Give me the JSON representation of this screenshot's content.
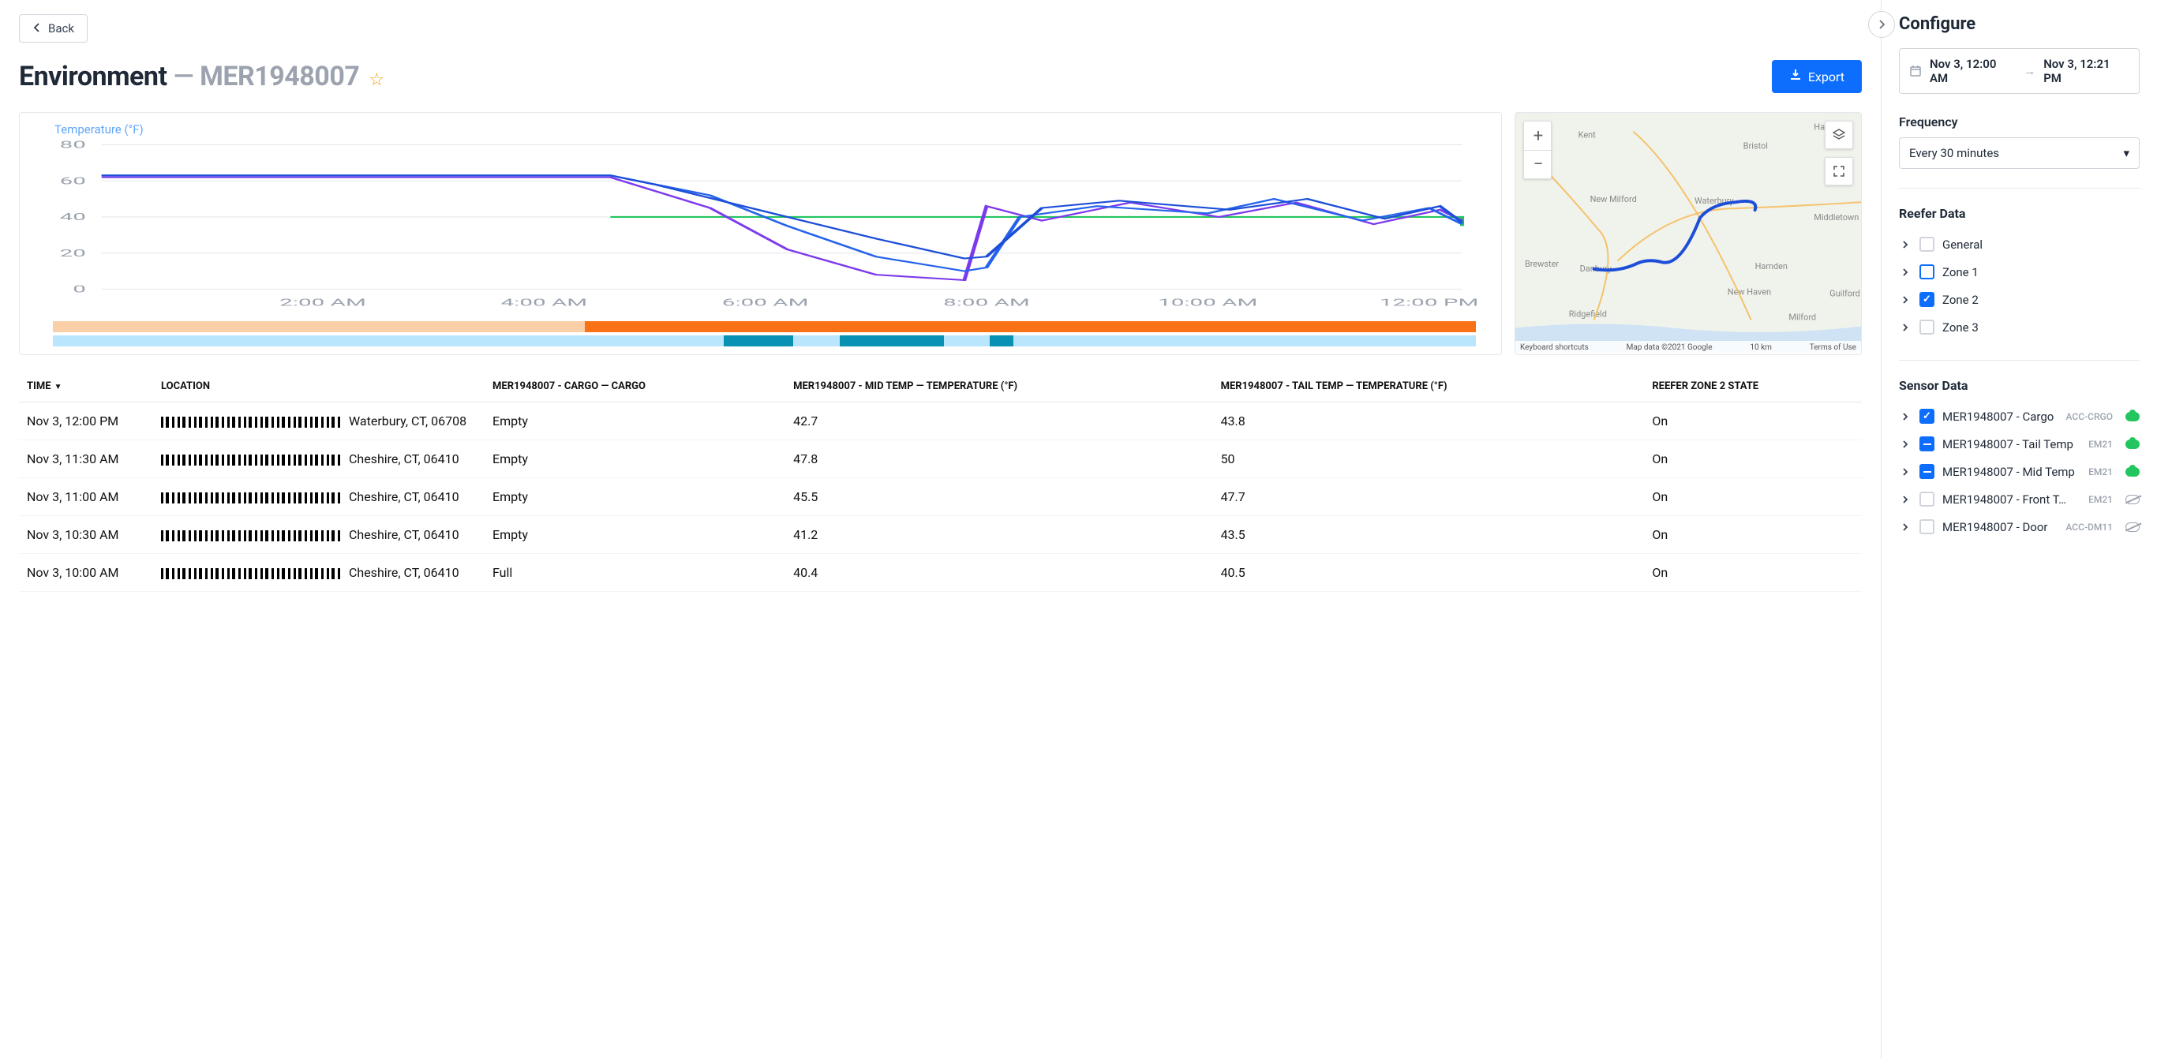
{
  "back_label": "Back",
  "title": "Environment",
  "asset_id": "MER1948007",
  "export_label": "Export",
  "chart_title": "Temperature (°F)",
  "chart_data": {
    "type": "line",
    "ylabel": "Temperature (°F)",
    "ylim": [
      0,
      80
    ],
    "x_time_range": [
      "00:00",
      "12:21"
    ],
    "x_ticks": [
      "2:00 AM",
      "4:00 AM",
      "6:00 AM",
      "8:00 AM",
      "10:00 AM",
      "12:00 PM"
    ],
    "y_ticks": [
      0,
      20,
      40,
      60,
      80
    ],
    "series": [
      {
        "name": "setpoint",
        "color": "#22c55e",
        "values": [
          [
            4.6,
            40
          ],
          [
            12.3,
            35
          ]
        ]
      },
      {
        "name": "mid_temp",
        "color": "#7c3aed",
        "values": [
          [
            0,
            62
          ],
          [
            4.6,
            62
          ],
          [
            5.5,
            45
          ],
          [
            6.2,
            22
          ],
          [
            7.0,
            8
          ],
          [
            7.8,
            5
          ],
          [
            8.0,
            46
          ],
          [
            8.5,
            38
          ],
          [
            9.3,
            48
          ],
          [
            10.1,
            40
          ],
          [
            10.8,
            48
          ],
          [
            11.5,
            36
          ],
          [
            12.1,
            44
          ],
          [
            12.3,
            38
          ]
        ]
      },
      {
        "name": "tail_temp",
        "color": "#2563eb",
        "values": [
          [
            0,
            63
          ],
          [
            4.6,
            63
          ],
          [
            5.5,
            52
          ],
          [
            6.2,
            35
          ],
          [
            7.0,
            18
          ],
          [
            7.8,
            10
          ],
          [
            8.0,
            12
          ],
          [
            8.3,
            40
          ],
          [
            9.0,
            46
          ],
          [
            10.0,
            42
          ],
          [
            10.6,
            50
          ],
          [
            11.4,
            38
          ],
          [
            12.0,
            45
          ],
          [
            12.3,
            36
          ]
        ]
      },
      {
        "name": "cargo",
        "color": "#1d4ed8",
        "values": [
          [
            0,
            63
          ],
          [
            4.6,
            63
          ],
          [
            5.0,
            58
          ],
          [
            6.0,
            43
          ],
          [
            7.0,
            28
          ],
          [
            7.8,
            17
          ],
          [
            8.0,
            18
          ],
          [
            8.5,
            45
          ],
          [
            9.2,
            49
          ],
          [
            10.2,
            44
          ],
          [
            10.9,
            50
          ],
          [
            11.6,
            39
          ],
          [
            12.1,
            46
          ],
          [
            12.3,
            37
          ]
        ]
      }
    ],
    "status_bars": [
      {
        "name": "reefer_state",
        "color": "#f97316",
        "segments": [
          [
            0,
            4.6,
            "#fbcfa8"
          ],
          [
            4.6,
            12.3,
            "#f97316"
          ]
        ]
      },
      {
        "name": "door",
        "color": "#0891b2",
        "segments": [
          [
            0,
            4.6,
            "#bae6fd"
          ],
          [
            4.6,
            5.8,
            "#bae6fd"
          ],
          [
            5.8,
            6.4,
            "#0891b2"
          ],
          [
            6.4,
            6.8,
            "#bae6fd"
          ],
          [
            6.8,
            7.7,
            "#0891b2"
          ],
          [
            7.7,
            8.1,
            "#bae6fd"
          ],
          [
            8.1,
            8.3,
            "#0891b2"
          ],
          [
            8.3,
            12.3,
            "#bae6fd"
          ]
        ]
      }
    ]
  },
  "map": {
    "attribution_shortcuts": "Keyboard shortcuts",
    "attribution_data": "Map data ©2021 Google",
    "attribution_scale": "10 km",
    "attribution_terms": "Terms of Use",
    "places": [
      "Kent",
      "Bristol",
      "Hartford",
      "New Milford",
      "Waterbury",
      "Middletown",
      "Brewster",
      "Danbury",
      "Ridgefield",
      "New Haven",
      "Hamden",
      "Milford",
      "Guilford"
    ]
  },
  "table": {
    "cols": [
      "TIME",
      "LOCATION",
      "MER1948007 - CARGO — CARGO",
      "MER1948007 - MID TEMP — TEMPERATURE (°F)",
      "MER1948007 - TAIL TEMP — TEMPERATURE (°F)",
      "REEFER ZONE 2 STATE"
    ],
    "sort_col": 0,
    "sort_dir": "desc",
    "rows": [
      {
        "time": "Nov 3, 12:00 PM",
        "location_suffix": "Waterbury, CT, 06708",
        "cargo": "Empty",
        "mid": "42.7",
        "tail": "43.8",
        "state": "On"
      },
      {
        "time": "Nov 3, 11:30 AM",
        "location_suffix": "Cheshire, CT, 06410",
        "cargo": "Empty",
        "mid": "47.8",
        "tail": "50",
        "state": "On"
      },
      {
        "time": "Nov 3, 11:00 AM",
        "location_suffix": "Cheshire, CT, 06410",
        "cargo": "Empty",
        "mid": "45.5",
        "tail": "47.7",
        "state": "On"
      },
      {
        "time": "Nov 3, 10:30 AM",
        "location_suffix": "Cheshire, CT, 06410",
        "cargo": "Empty",
        "mid": "41.2",
        "tail": "43.5",
        "state": "On"
      },
      {
        "time": "Nov 3, 10:00 AM",
        "location_suffix": "Cheshire, CT, 06410",
        "cargo": "Full",
        "mid": "40.4",
        "tail": "40.5",
        "state": "On"
      }
    ]
  },
  "sidebar": {
    "heading": "Configure",
    "date_from": "Nov 3, 12:00 AM",
    "date_to": "Nov 3, 12:21 PM",
    "frequency_label": "Frequency",
    "frequency_value": "Every 30 minutes",
    "reefer_heading": "Reefer Data",
    "reefer_items": [
      {
        "label": "General",
        "state": "unchecked"
      },
      {
        "label": "Zone 1",
        "state": "outlined"
      },
      {
        "label": "Zone 2",
        "state": "checked"
      },
      {
        "label": "Zone 3",
        "state": "unchecked"
      }
    ],
    "sensor_heading": "Sensor Data",
    "sensor_items": [
      {
        "label": "MER1948007 - Cargo",
        "state": "checked",
        "tag": "ACC-CRGO",
        "cloud": "solid"
      },
      {
        "label": "MER1948007 - Tail Temp",
        "state": "partial",
        "tag": "EM21",
        "cloud": "solid"
      },
      {
        "label": "MER1948007 - Mid Temp",
        "state": "partial",
        "tag": "EM21",
        "cloud": "solid"
      },
      {
        "label": "MER1948007 - Front T…",
        "state": "unchecked",
        "tag": "EM21",
        "cloud": "outline"
      },
      {
        "label": "MER1948007 - Door",
        "state": "unchecked",
        "tag": "ACC-DM11",
        "cloud": "outline"
      }
    ]
  }
}
